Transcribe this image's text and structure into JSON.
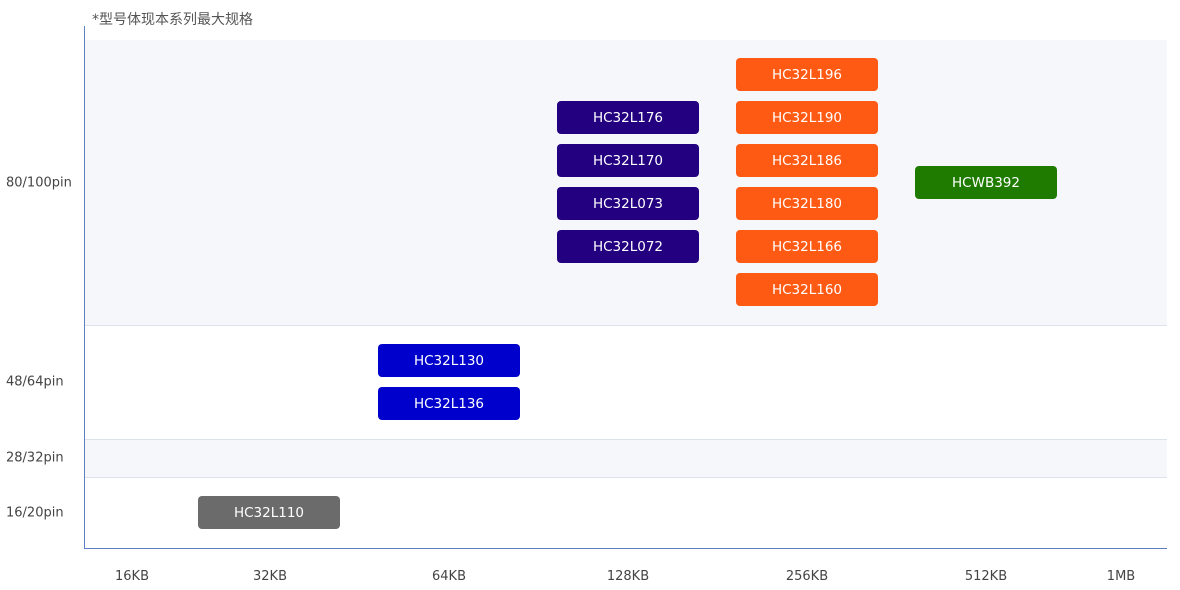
{
  "chart_data": {
    "type": "table",
    "note": "*型号体现本系列最大规格",
    "xlabel": "",
    "ylabel": "",
    "x_categories": [
      "16KB",
      "32KB",
      "64KB",
      "128KB",
      "256KB",
      "512KB",
      "1MB"
    ],
    "y_categories": [
      "80/100pin",
      "48/64pin",
      "28/32pin",
      "16/20pin"
    ],
    "colors": {
      "gray": "#6b6b6b",
      "blue": "#0000cc",
      "indigo": "#22007f",
      "orange": "#ff5a13",
      "green": "#1e7b00"
    },
    "items": [
      {
        "label": "HC32L110",
        "flash": "32KB",
        "pins": "16/20pin",
        "color": "gray"
      },
      {
        "label": "HC32L130",
        "flash": "64KB",
        "pins": "48/64pin",
        "color": "blue"
      },
      {
        "label": "HC32L136",
        "flash": "64KB",
        "pins": "48/64pin",
        "color": "blue"
      },
      {
        "label": "HC32L176",
        "flash": "128KB",
        "pins": "80/100pin",
        "color": "indigo"
      },
      {
        "label": "HC32L170",
        "flash": "128KB",
        "pins": "80/100pin",
        "color": "indigo"
      },
      {
        "label": "HC32L073",
        "flash": "128KB",
        "pins": "80/100pin",
        "color": "indigo"
      },
      {
        "label": "HC32L072",
        "flash": "128KB",
        "pins": "80/100pin",
        "color": "indigo"
      },
      {
        "label": "HC32L196",
        "flash": "256KB",
        "pins": "80/100pin",
        "color": "orange"
      },
      {
        "label": "HC32L190",
        "flash": "256KB",
        "pins": "80/100pin",
        "color": "orange"
      },
      {
        "label": "HC32L186",
        "flash": "256KB",
        "pins": "80/100pin",
        "color": "orange"
      },
      {
        "label": "HC32L180",
        "flash": "256KB",
        "pins": "80/100pin",
        "color": "orange"
      },
      {
        "label": "HC32L166",
        "flash": "256KB",
        "pins": "80/100pin",
        "color": "orange"
      },
      {
        "label": "HC32L160",
        "flash": "256KB",
        "pins": "80/100pin",
        "color": "orange"
      },
      {
        "label": "HCWB392",
        "flash": "512KB",
        "pins": "80/100pin",
        "color": "green"
      }
    ]
  }
}
